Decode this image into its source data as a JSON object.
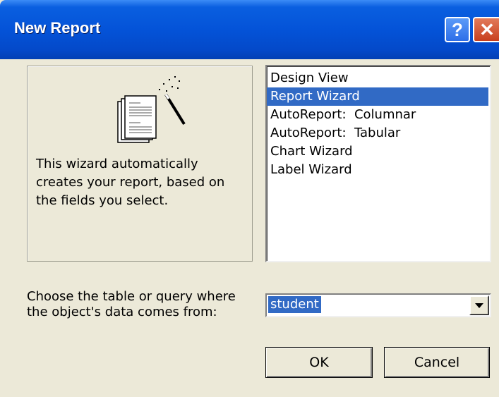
{
  "window": {
    "title": "New Report",
    "help_label": "?",
    "close_label": "✕"
  },
  "preview": {
    "description": "This wizard automatically creates your report, based on the fields you select."
  },
  "report_types": {
    "items": [
      "Design View",
      "Report Wizard",
      "AutoReport:  Columnar",
      "AutoReport:  Tabular",
      "Chart Wizard",
      "Label Wizard"
    ],
    "selected": "Report Wizard"
  },
  "source": {
    "prompt": "Choose the table or query where the object's data comes from:",
    "value": "student"
  },
  "buttons": {
    "ok": "OK",
    "cancel": "Cancel"
  },
  "colors": {
    "titlebar": "#0453d8",
    "selection": "#316ac5",
    "dialog_bg": "#ece9d8"
  }
}
